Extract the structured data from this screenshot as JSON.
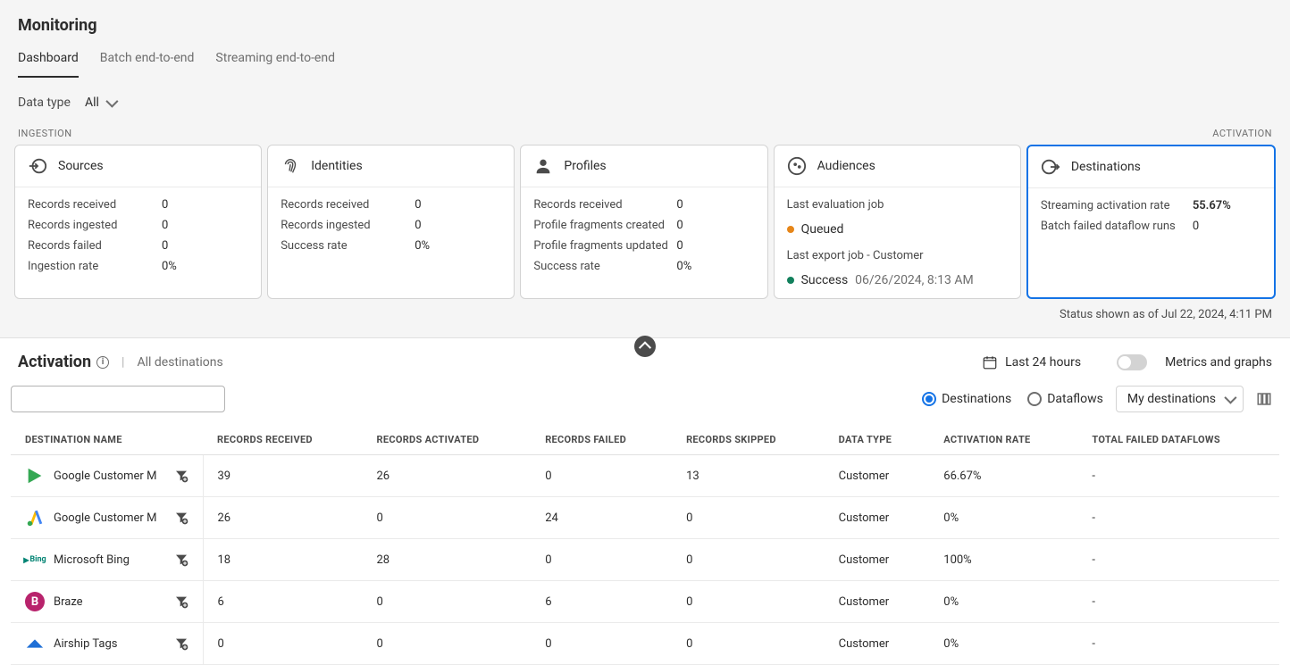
{
  "pageTitle": "Monitoring",
  "tabs": [
    "Dashboard",
    "Batch end-to-end",
    "Streaming end-to-end"
  ],
  "activeTab": 0,
  "dataTypeLabel": "Data type",
  "dataTypeValue": "All",
  "ingestionLabel": "INGESTION",
  "activationLabel": "ACTIVATION",
  "cards": {
    "sources": {
      "title": "Sources",
      "metrics": [
        {
          "label": "Records received",
          "value": "0"
        },
        {
          "label": "Records ingested",
          "value": "0"
        },
        {
          "label": "Records failed",
          "value": "0"
        },
        {
          "label": "Ingestion rate",
          "value": "0%"
        }
      ]
    },
    "identities": {
      "title": "Identities",
      "metrics": [
        {
          "label": "Records received",
          "value": "0"
        },
        {
          "label": "Records ingested",
          "value": "0"
        },
        {
          "label": "Success rate",
          "value": "0%"
        }
      ]
    },
    "profiles": {
      "title": "Profiles",
      "metrics": [
        {
          "label": "Records received",
          "value": "0"
        },
        {
          "label": "Profile fragments created",
          "value": "0"
        },
        {
          "label": "Profile fragments updated",
          "value": "0"
        },
        {
          "label": "Success rate",
          "value": "0%"
        }
      ]
    },
    "audiences": {
      "title": "Audiences",
      "lastEvalLabel": "Last evaluation job",
      "lastEvalStatus": "Queued",
      "lastExportLabel": "Last export job - Customer",
      "lastExportStatus": "Success",
      "lastExportTime": "06/26/2024, 8:13 AM"
    },
    "destinations": {
      "title": "Destinations",
      "metrics": [
        {
          "label": "Streaming activation rate",
          "value": "55.67%"
        },
        {
          "label": "Batch failed dataflow runs",
          "value": "0"
        }
      ]
    }
  },
  "statusLine": "Status shown as of Jul 22, 2024, 4:11 PM",
  "activation": {
    "title": "Activation",
    "subtitle": "All destinations",
    "timeRange": "Last 24 hours",
    "toggleLabel": "Metrics and graphs",
    "viewOptions": {
      "destinations": "Destinations",
      "dataflows": "Dataflows"
    },
    "selected": "Destinations",
    "scopeSelect": "My destinations"
  },
  "table": {
    "headers": [
      "DESTINATION NAME",
      "RECORDS RECEIVED",
      "RECORDS ACTIVATED",
      "RECORDS FAILED",
      "RECORDS SKIPPED",
      "DATA TYPE",
      "ACTIVATION RATE",
      "TOTAL FAILED DATAFLOWS"
    ],
    "rows": [
      {
        "icon": "google-play",
        "name": "Google Customer M",
        "received": "39",
        "activated": "26",
        "failed": "0",
        "skipped": "13",
        "dtype": "Customer",
        "rate": "66.67%",
        "tfd": "-"
      },
      {
        "icon": "google-ads",
        "name": "Google Customer M",
        "received": "26",
        "activated": "0",
        "failed": "24",
        "skipped": "0",
        "dtype": "Customer",
        "rate": "0%",
        "tfd": "-"
      },
      {
        "icon": "bing",
        "name": "Microsoft Bing",
        "received": "18",
        "activated": "28",
        "failed": "0",
        "skipped": "0",
        "dtype": "Customer",
        "rate": "100%",
        "tfd": "-"
      },
      {
        "icon": "braze",
        "name": "Braze",
        "received": "6",
        "activated": "0",
        "failed": "6",
        "skipped": "0",
        "dtype": "Customer",
        "rate": "0%",
        "tfd": "-"
      },
      {
        "icon": "airship",
        "name": "Airship Tags",
        "received": "0",
        "activated": "0",
        "failed": "0",
        "skipped": "0",
        "dtype": "Customer",
        "rate": "0%",
        "tfd": "-"
      }
    ]
  }
}
